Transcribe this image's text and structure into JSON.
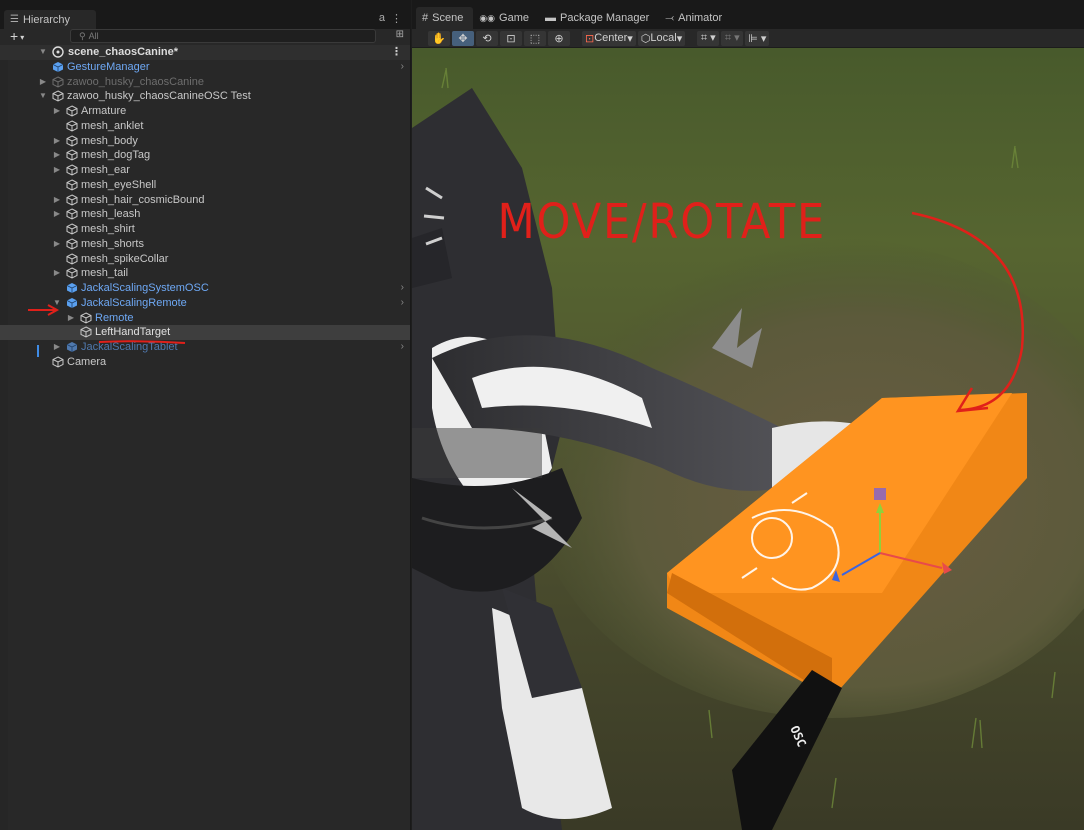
{
  "hierarchy": {
    "tab_label": "Hierarchy",
    "search_placeholder": "All",
    "scene_name": "scene_chaosCanine*",
    "items": [
      {
        "label": "GestureManager",
        "indent": 1,
        "arrow": "",
        "style": "blue",
        "icon": "prefab",
        "chevron": true
      },
      {
        "label": "zawoo_husky_chaosCanine",
        "indent": 1,
        "arrow": "right",
        "style": "dim",
        "icon": "gameobject",
        "chevron": false
      },
      {
        "label": "zawoo_husky_chaosCanineOSC Test",
        "indent": 1,
        "arrow": "down",
        "style": "normal",
        "icon": "gameobject",
        "chevron": false
      },
      {
        "label": "Armature",
        "indent": 2,
        "arrow": "right",
        "style": "normal",
        "icon": "gameobject",
        "chevron": false
      },
      {
        "label": "mesh_anklet",
        "indent": 2,
        "arrow": "",
        "style": "normal",
        "icon": "gameobject",
        "chevron": false
      },
      {
        "label": "mesh_body",
        "indent": 2,
        "arrow": "right",
        "style": "normal",
        "icon": "gameobject",
        "chevron": false
      },
      {
        "label": "mesh_dogTag",
        "indent": 2,
        "arrow": "right",
        "style": "normal",
        "icon": "gameobject",
        "chevron": false
      },
      {
        "label": "mesh_ear",
        "indent": 2,
        "arrow": "right",
        "style": "normal",
        "icon": "gameobject",
        "chevron": false
      },
      {
        "label": "mesh_eyeShell",
        "indent": 2,
        "arrow": "",
        "style": "normal",
        "icon": "gameobject",
        "chevron": false
      },
      {
        "label": "mesh_hair_cosmicBound",
        "indent": 2,
        "arrow": "right",
        "style": "normal",
        "icon": "gameobject",
        "chevron": false
      },
      {
        "label": "mesh_leash",
        "indent": 2,
        "arrow": "right",
        "style": "normal",
        "icon": "gameobject",
        "chevron": false
      },
      {
        "label": "mesh_shirt",
        "indent": 2,
        "arrow": "",
        "style": "normal",
        "icon": "gameobject",
        "chevron": false
      },
      {
        "label": "mesh_shorts",
        "indent": 2,
        "arrow": "right",
        "style": "normal",
        "icon": "gameobject",
        "chevron": false
      },
      {
        "label": "mesh_spikeCollar",
        "indent": 2,
        "arrow": "",
        "style": "normal",
        "icon": "gameobject",
        "chevron": false
      },
      {
        "label": "mesh_tail",
        "indent": 2,
        "arrow": "right",
        "style": "normal",
        "icon": "gameobject",
        "chevron": false
      },
      {
        "label": "JackalScalingSystemOSC",
        "indent": 2,
        "arrow": "",
        "style": "blue",
        "icon": "prefab",
        "chevron": true
      },
      {
        "label": "JackalScalingRemote",
        "indent": 2,
        "arrow": "down",
        "style": "blue",
        "icon": "prefab",
        "chevron": true
      },
      {
        "label": "Remote",
        "indent": 3,
        "arrow": "right",
        "style": "blue",
        "icon": "gameobject",
        "chevron": false
      },
      {
        "label": "LeftHandTarget",
        "indent": 3,
        "arrow": "",
        "style": "selected",
        "icon": "gameobject",
        "chevron": false
      },
      {
        "label": "JackalScalingTablet",
        "indent": 2,
        "arrow": "right",
        "style": "dimblue",
        "icon": "prefab",
        "chevron": true
      },
      {
        "label": "Camera",
        "indent": 1,
        "arrow": "",
        "style": "normal",
        "icon": "gameobject",
        "chevron": false
      }
    ]
  },
  "scene": {
    "tabs": [
      {
        "label": "Scene",
        "icon": "grid-icon",
        "active": true
      },
      {
        "label": "Game",
        "icon": "gamepad-icon",
        "active": false
      },
      {
        "label": "Package Manager",
        "icon": "package-icon",
        "active": false
      },
      {
        "label": "Animator",
        "icon": "animator-icon",
        "active": false
      }
    ],
    "toolbar": {
      "pivot_label": "Center",
      "space_label": "Local"
    },
    "annotation_text": "MOVE/ROTATE",
    "tablet_text": "OSC",
    "colors": {
      "tablet_orange": "#ff8c14",
      "annotation_red": "#e0201a",
      "prefab_blue": "#6ea8f4",
      "selection_bg": "#3e3e3e"
    }
  }
}
